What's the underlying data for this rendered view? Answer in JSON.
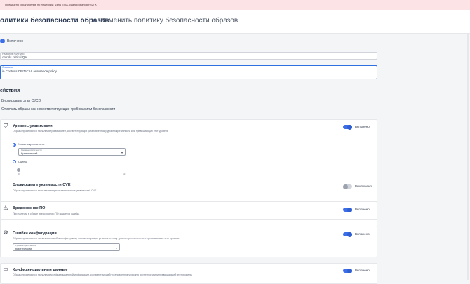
{
  "banner": {
    "text": "Превышено ограничение по лицензии: узлы EOA, сканирования RS/TX"
  },
  "breadcrumb": {
    "root": "олитики безопасности образов",
    "separator": "›",
    "current": "Изменить политику безопасности образов"
  },
  "enabled_label": "Включено",
  "fields": {
    "name": {
      "label": "Название политики",
      "value": "ontrols critical QA"
    },
    "description": {
      "label": "Описание",
      "value": "in Controls CRITICAL assurance policy"
    }
  },
  "actions": {
    "title": "ействия",
    "block_ci": "Блокировать этап CI/CD",
    "mark_noncompliant": "Отмечать образы как несоответствующие требованиям безопасности"
  },
  "vuln": {
    "title": "Уровень уязвимости",
    "desc": "Образы проверяются на наличие уязвимостей, соответствующих установленному уровню критичности или превышающих этот уровень",
    "toggle_label": "Включено",
    "toggle_on": true,
    "radio_severity": "Уровень критичности",
    "severity_select": {
      "label": "Уровень критичности",
      "value": "Критический"
    },
    "radio_score": "Оценка",
    "score_min": "0",
    "score_max": "10",
    "score_value": 0,
    "cve_title": "Блокировать уязвимости CVE",
    "cve_desc": "Образы проверяются на наличие перечисленных ниже уязвимостей CVE",
    "cve_toggle_label": "Выключено",
    "cve_toggle_on": false
  },
  "malware": {
    "title": "Вредоносное ПО",
    "desc": "При наличии в образе вредоносного ПО выдается ошибка",
    "toggle_label": "Включено",
    "toggle_on": true
  },
  "misconfig": {
    "title": "Ошибки конфигурации",
    "desc": "Образы проверяются на наличие ошибок конфигурации, соответствующих установленному уровню критичности или превышающих этот уровень",
    "toggle_label": "Включено",
    "toggle_on": true,
    "select": {
      "label": "Уровень критичности",
      "value": "Критический"
    }
  },
  "secrets": {
    "title": "Конфиденциальные данные",
    "desc": "Образы проверяются на наличие конфиденциальной информации, соответствующей установленному уровню критичности или превышающей этот уровень",
    "toggle_label": "Включено",
    "toggle_on": true
  },
  "icons": {
    "vuln": "shield-icon",
    "malware": "bug-icon",
    "misconfig": "settings-icon",
    "secrets": "card-icon"
  },
  "colors": {
    "accent": "#3b6ee8",
    "banner_bg": "#fbe3e6"
  }
}
